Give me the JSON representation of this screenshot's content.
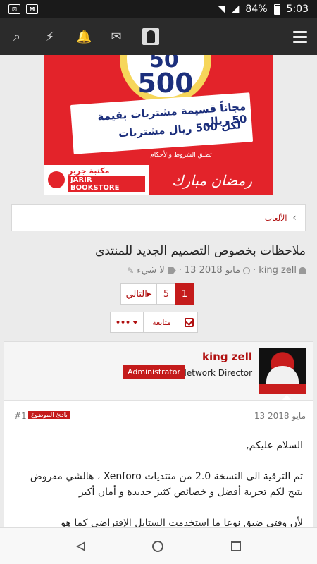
{
  "status_bar": {
    "battery": "84%",
    "time": "5:03"
  },
  "ad": {
    "amount_small": "50",
    "amount_big": "500",
    "line1": "مجاناً قسيمة مشتريات بقيمة 50 ريال",
    "line2": "لكل 500 ريال مشتريات",
    "terms": "تطبق الشروط والأحكام",
    "logo_ar": "مكتبة جرير",
    "logo_en": "JARIR BOOKSTORE",
    "ramadan": "رمضان مبارك"
  },
  "breadcrumb": {
    "item": "الألعاب"
  },
  "thread": {
    "title": "ملاحظات بخصوص التصميم الجديد للمنتدى",
    "author": "king zell",
    "date": "13 مايو 2018",
    "tags": "لا شيء"
  },
  "pagination": {
    "next_label": "التالي",
    "pages": [
      "5",
      "1"
    ]
  },
  "actions": {
    "more_label": "•••",
    "follow_label": "متابعة"
  },
  "post": {
    "username": "king zell",
    "user_title": "Network Director",
    "badge": "Administrator",
    "date": "13 مايو 2018",
    "number": "#1",
    "starter_label": "بادئ الموضوع",
    "paragraphs": [
      "السلام عليكم,",
      "تم الترقية الى النسخة 2.0 من منتديات Xenforo ، هالشي مفروض يتيح لكم تجربة أفضل و خصائص كثير جديدة و أمان أكبر",
      "لأن وقتي ضيق نوعا ما استخدمت الستايل الإفتراضي كما هو"
    ]
  }
}
